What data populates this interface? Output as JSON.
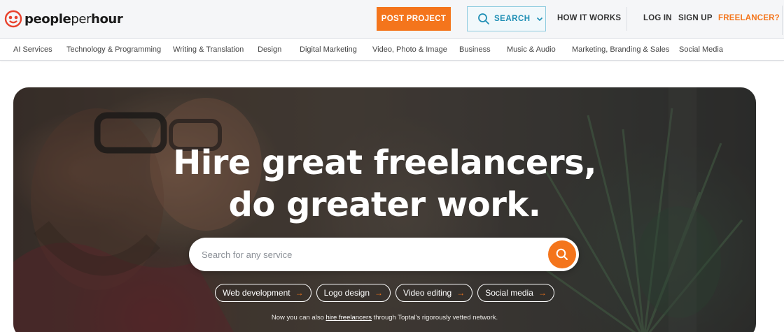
{
  "brand": {
    "name_bold_1": "people",
    "name_light": "per",
    "name_bold_2": "hour",
    "accent": "#f4751c",
    "link_blue": "#1f8fb5"
  },
  "nav": {
    "post_project": "POST PROJECT",
    "search": "SEARCH",
    "how_it_works": "HOW IT WORKS",
    "log_in": "LOG IN",
    "sign_up": "SIGN UP",
    "freelancer": "FREELANCER?"
  },
  "categories": [
    "AI Services",
    "Technology & Programming",
    "Writing & Translation",
    "Design",
    "Digital Marketing",
    "Video, Photo & Image",
    "Business",
    "Music & Audio",
    "Marketing, Branding & Sales",
    "Social Media"
  ],
  "hero": {
    "title_line1": "Hire great freelancers,",
    "title_line2": "do greater work.",
    "search_placeholder": "Search for any service",
    "chips": [
      "Web development",
      "Logo design",
      "Video editing",
      "Social media"
    ],
    "note_prefix": "Now you can also ",
    "note_link": "hire freelancers",
    "note_suffix": " through Toptal's rigorously vetted network."
  },
  "icons": {
    "logo": "smiley-face-icon",
    "search": "search-icon",
    "dropdown": "chevron-down-icon",
    "chip_arrow": "arrow-right-icon"
  }
}
